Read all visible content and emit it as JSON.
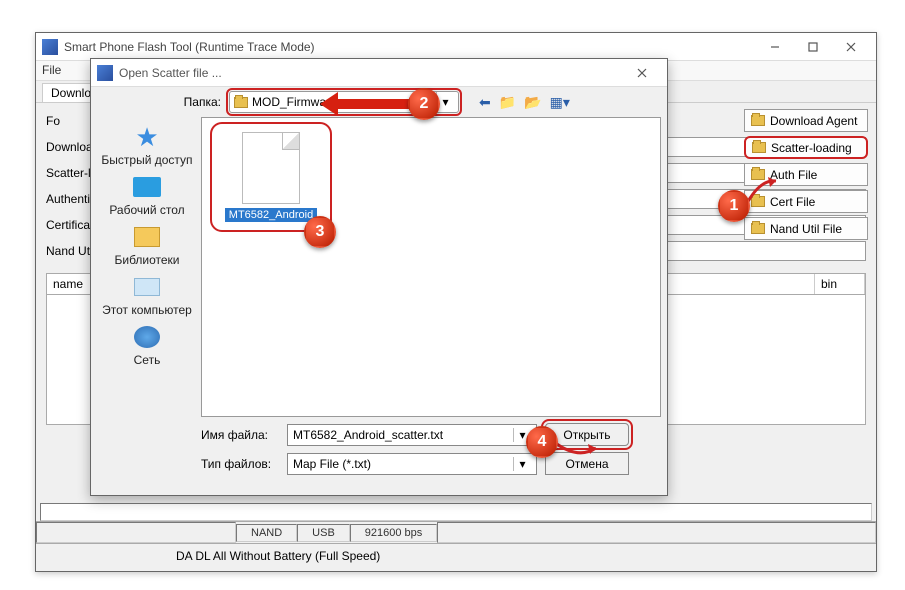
{
  "main_window": {
    "title": "Smart Phone Flash Tool (Runtime Trace Mode)",
    "menubar": {
      "file": "File"
    },
    "tabs": {
      "download": "Download"
    },
    "field_labels": {
      "fo": "Fo",
      "download": "Download",
      "scatter": "Scatter-lo",
      "authentic": "Authentic",
      "cert": "Certificatio",
      "nand": "Nand Util"
    },
    "grid": {
      "name_col": "name",
      "bin_col": "bin"
    },
    "right_buttons": {
      "download_agent": "Download Agent",
      "scatter_loading": "Scatter-loading",
      "auth_file": "Auth File",
      "cert_file": "Cert File",
      "nand_util": "Nand Util File"
    },
    "status": {
      "nand": "NAND",
      "usb": "USB",
      "baud": "921600 bps",
      "mode": "DA DL All Without Battery (Full Speed)"
    }
  },
  "dialog": {
    "title": "Open Scatter file ...",
    "folder_label": "Папка:",
    "folder_value": "MOD_Firmware",
    "places": {
      "quick": "Быстрый доступ",
      "desktop": "Рабочий стол",
      "libraries": "Библиотеки",
      "computer": "Этот компьютер",
      "network": "Сеть"
    },
    "file_display": "MT6582_Android",
    "filename_label": "Имя файла:",
    "filename_value": "MT6582_Android_scatter.txt",
    "filetype_label": "Тип файлов:",
    "filetype_value": "Map File (*.txt)",
    "btn_open": "Открыть",
    "btn_cancel": "Отмена"
  },
  "badges": {
    "b1": "1",
    "b2": "2",
    "b3": "3",
    "b4": "4"
  }
}
